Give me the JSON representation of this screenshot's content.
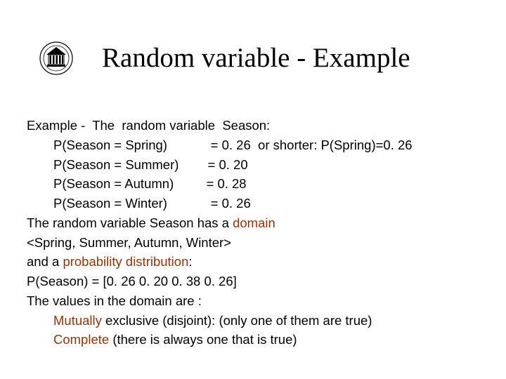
{
  "title": "Random variable - Example",
  "body": {
    "l0": "Example -  The  random variable  Season:",
    "r1a": "P(Season = Spring)",
    "r1b": "= 0. 26  or shorter: P(Spring)=0. 26",
    "r2a": "P(Season = Summer)",
    "r2b": "= 0. 20",
    "r3a": "P(Season = Autumn)",
    "r3b": "= 0. 28",
    "r4a": "P(Season = Winter)",
    "r4b": "= 0. 26",
    "l5a": "The random variable Season has a ",
    "l5b": "domain",
    "l6": "<Spring, Summer, Autumn, Winter>",
    "l7a": "and a ",
    "l7b": "probability distribution",
    "l7c": ":",
    "l8": "P(Season) = [0. 26 0. 20 0. 38 0. 26]",
    "l9": "The values in the domain are :",
    "l10a": "Mutually",
    "l10b": " exclusive (disjoint): (only one of them are true)",
    "l11a": "Complete",
    "l11b": " (there is always one that is true)"
  }
}
